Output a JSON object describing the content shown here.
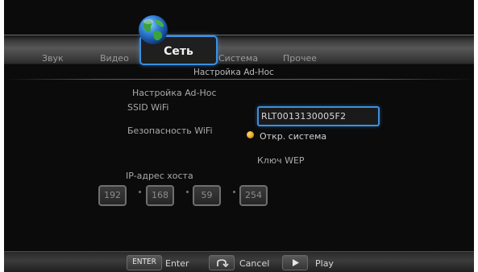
{
  "tabs": {
    "sound": "Звук",
    "video": "Видео",
    "network": "Сеть",
    "system": "Система",
    "other": "Прочее"
  },
  "subtitle": "Настройка Ad-Hoc",
  "form": {
    "section_label": "Настройка Ad-Hoc",
    "ssid_label": "SSID WiFi",
    "ssid_value": "RLT0013130005F2",
    "security_label": "Безопасность WiFi",
    "security_option": "Откр. система",
    "wep_key_label": "Ключ WEP",
    "host_ip_label": "IP-адрес хоста",
    "host_ip": [
      "192",
      "168",
      "59",
      "254"
    ]
  },
  "footer": {
    "enter_key": "ENTER",
    "enter_label": "Enter",
    "cancel_label": "Cancel",
    "play_label": "Play"
  },
  "colors": {
    "accent": "#3d8fe0",
    "radio": "#e0a020"
  },
  "icons": {
    "network_tab": "globe-icon",
    "cancel": "return-arrow-icon",
    "play": "play-triangle-icon"
  }
}
